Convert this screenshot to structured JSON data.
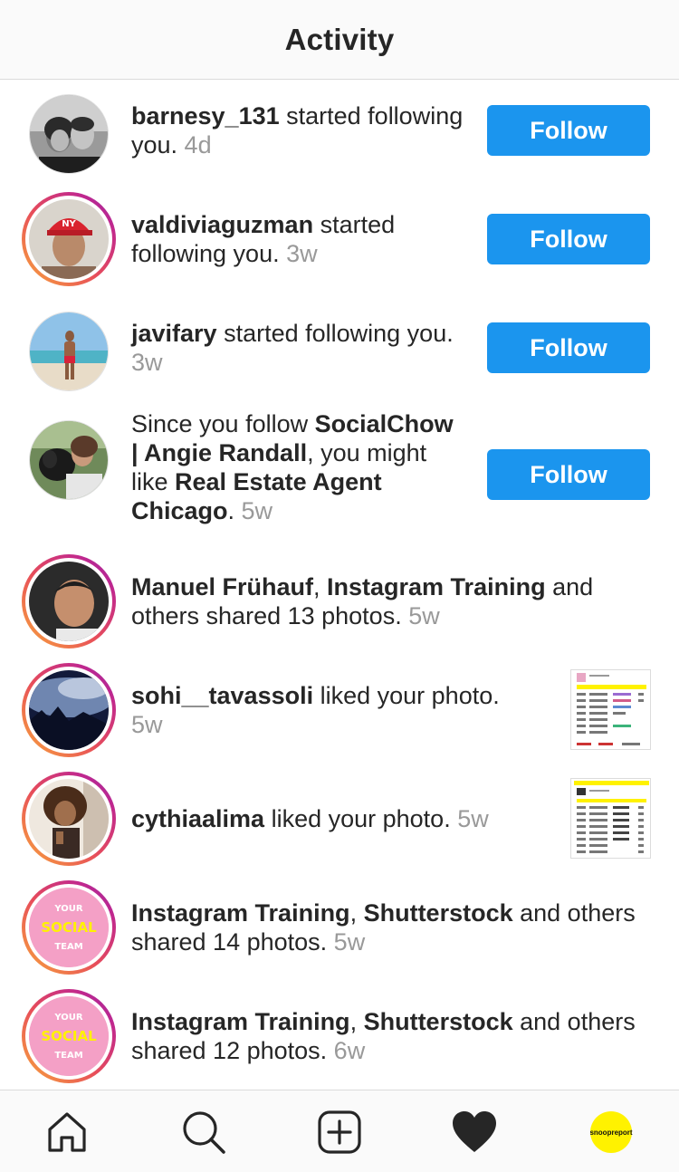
{
  "header": {
    "title": "Activity"
  },
  "feed": {
    "row1": {
      "user": "barnesy_131",
      "text": " started following you.",
      "time": " 4d",
      "button": "Follow"
    },
    "row2": {
      "user": "valdiviaguzman",
      "text": " started following you.",
      "time": " 3w",
      "button": "Follow"
    },
    "row3": {
      "user": "javifary",
      "text": " started following you.",
      "time": " 3w",
      "button": "Follow"
    },
    "row4": {
      "prefix": "Since you follow ",
      "user1": "SocialChow | Angie Randall",
      "middle": ", you might like ",
      "user2": "Real Estate Agent Chicago",
      "suffix": ".",
      "time": " 5w",
      "button": "Follow"
    },
    "row5": {
      "user1": "Manuel Frühauf",
      "sep": ", ",
      "user2": "Instagram Training",
      "text": " and others shared 13 photos.",
      "time": " 5w"
    },
    "row6": {
      "user": "sohi__tavassoli",
      "text": " liked your photo.",
      "time": " 5w"
    },
    "row7": {
      "user": "cythiaalima",
      "text": " liked your photo.",
      "time": " 5w"
    },
    "row8": {
      "user1": "Instagram Training",
      "sep": ", ",
      "user2": "Shutterstock",
      "text": " and others shared 14 photos.",
      "time": " 5w",
      "avatar_lines": [
        "YOUR",
        "SOCIAL",
        "TEAM"
      ]
    },
    "row9": {
      "user1": "Instagram Training",
      "sep": ", ",
      "user2": "Shutterstock",
      "text": " and others shared 12 photos.",
      "time": " 6w",
      "avatar_lines": [
        "YOUR",
        "SOCIAL",
        "TEAM"
      ]
    }
  },
  "tabbar": {
    "profile_label": "snoopreport"
  },
  "colors": {
    "follow_blue": "#1b95ee",
    "profile_yellow": "#fff200",
    "ring_orange": "#f9a93b",
    "ring_purple": "#8f2aa8"
  },
  "icons": [
    "home-icon",
    "search-icon",
    "add-post-icon",
    "heart-icon"
  ]
}
